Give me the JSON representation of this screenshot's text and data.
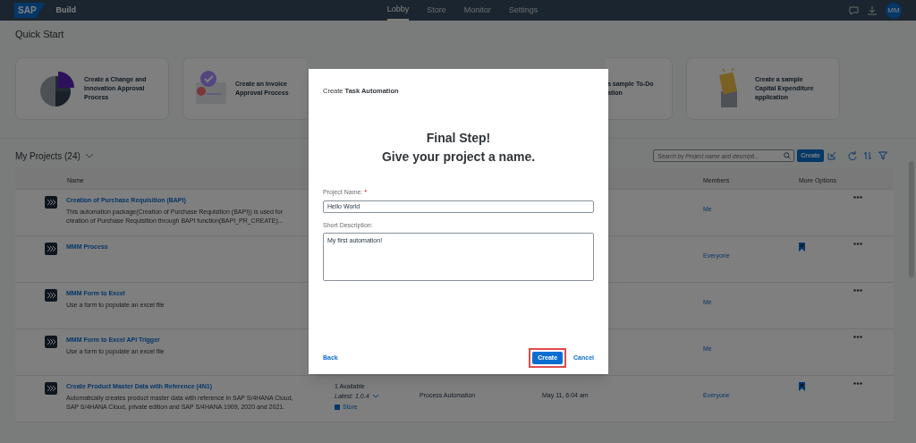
{
  "shell_bar": {
    "logo": "SAP",
    "product": "Build",
    "tabs": [
      {
        "label": "Lobby",
        "selected": true
      },
      {
        "label": "Store",
        "selected": false
      },
      {
        "label": "Monitor",
        "selected": false
      },
      {
        "label": "Settings",
        "selected": false
      }
    ],
    "avatar": "MM"
  },
  "quick_start": {
    "title": "Quick Start",
    "cards": [
      {
        "kind": "chart",
        "lines": [
          "Create a Change and",
          "Innovation Approval",
          "Process"
        ]
      },
      {
        "kind": "invoice",
        "lines": [
          "Create an Invoice",
          "Approval Process"
        ]
      },
      {
        "kind": "todo",
        "lines": [
          "a sample To-Do",
          "ation"
        ]
      },
      {
        "kind": "capex",
        "lines": [
          "Create a sample",
          "Capital Expenditure",
          "application"
        ]
      }
    ]
  },
  "projects": {
    "title": "My Projects (24)",
    "search": {
      "placeholder": "Search by Project name and descripti..."
    },
    "create_button": "Create",
    "columns": [
      "Name",
      "",
      "",
      "",
      "Members",
      "More Options"
    ],
    "rows": [
      {
        "title": "Creation of Purchase Requisition (BAPI)",
        "description": "This automation package(Creation of Purchase Requisition (BAPI)) is used for creation of Purchase Requisition through BAPI function(BAPI_PR_CREATE)...",
        "members": "Me",
        "shared": false
      },
      {
        "title": "MMM Process",
        "description": "",
        "members": "Everyone",
        "shared": true
      },
      {
        "title": "MMM Form to Excel",
        "description": "Use a form to populate an excel file",
        "members": "Me",
        "shared": false
      },
      {
        "title": "MMM Form to Excel API Trigger",
        "description": "Use a form to populate an excel file",
        "members": "Me",
        "shared": false
      },
      {
        "title": "Create Product Master Data with Reference (4N1)",
        "description": "Automatically creates product master data with reference in SAP S/4HANA Cloud, SAP S/4HANA Cloud, private edition and SAP S/4HANA 1909, 2020 and 2021.",
        "available": "1 Available",
        "latest": "Latest: 1.0.4",
        "store": "Store",
        "type": "Process Automation",
        "modified": "May 11, 6:04 am",
        "members": "Everyone",
        "shared": true
      }
    ]
  },
  "dialog": {
    "header": "Create **Task Automation**",
    "title_lines": [
      "Final Step!",
      "Give your project a name."
    ],
    "fields": [
      {
        "kind": "input",
        "label": "Project Name:",
        "required_mark": "*",
        "value": "Hello World"
      },
      {
        "kind": "textarea",
        "label": "Short Description:",
        "value": "My first automation!"
      }
    ],
    "back": "Back",
    "create": "Create",
    "create_highlighted": true,
    "cancel": "Cancel"
  }
}
